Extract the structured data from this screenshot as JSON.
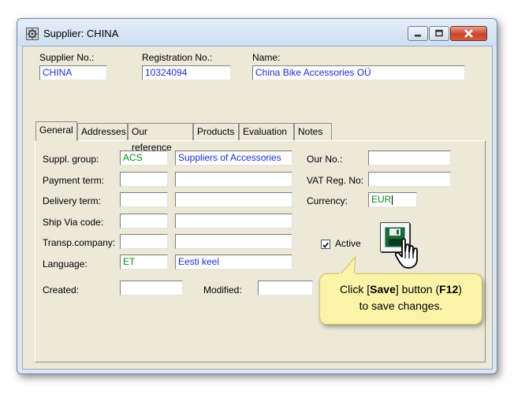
{
  "window": {
    "title": "Supplier: CHINA"
  },
  "header": {
    "supplier_no": {
      "label": "Supplier No.:",
      "value": "CHINA"
    },
    "registration_no": {
      "label": "Registration No.:",
      "value": "10324094"
    },
    "name": {
      "label": "Name:",
      "value": "China Bike Accessories OÜ"
    }
  },
  "tabs": [
    {
      "label": "General",
      "active": true
    },
    {
      "label": "Addresses"
    },
    {
      "label": "Our reference"
    },
    {
      "label": "Products"
    },
    {
      "label": "Evaluation"
    },
    {
      "label": "Notes"
    }
  ],
  "general": {
    "suppl_group": {
      "label": "Suppl. group:",
      "code": "ACS",
      "desc": "Suppliers of Accessories"
    },
    "payment_term": {
      "label": "Payment term:",
      "code": "",
      "desc": ""
    },
    "delivery_term": {
      "label": "Delivery term:",
      "code": "",
      "desc": ""
    },
    "ship_via": {
      "label": "Ship Via code:",
      "code": "",
      "desc": ""
    },
    "transp_company": {
      "label": "Transp.company:",
      "code": "",
      "desc": ""
    },
    "language": {
      "label": "Language:",
      "code": "ET",
      "desc": "Eesti keel"
    },
    "created": {
      "label": "Created:",
      "value": ""
    },
    "modified": {
      "label": "Modified:",
      "value": ""
    },
    "our_no": {
      "label": "Our No.:",
      "value": ""
    },
    "vat_reg_no": {
      "label": "VAT Reg. No:",
      "value": ""
    },
    "currency": {
      "label": "Currency:",
      "value": "EUR"
    },
    "active": {
      "label": "Active",
      "checked": true
    }
  },
  "callout": {
    "prefix": "Click [",
    "save_word": "Save",
    "middle": "] button (",
    "key": "F12",
    "suffix": ")",
    "line2": "to save changes."
  },
  "icons": [
    "supplier-window-icon",
    "minimize-icon",
    "maximize-icon",
    "close-icon",
    "save-disk-icon",
    "hand-cursor-icon"
  ]
}
